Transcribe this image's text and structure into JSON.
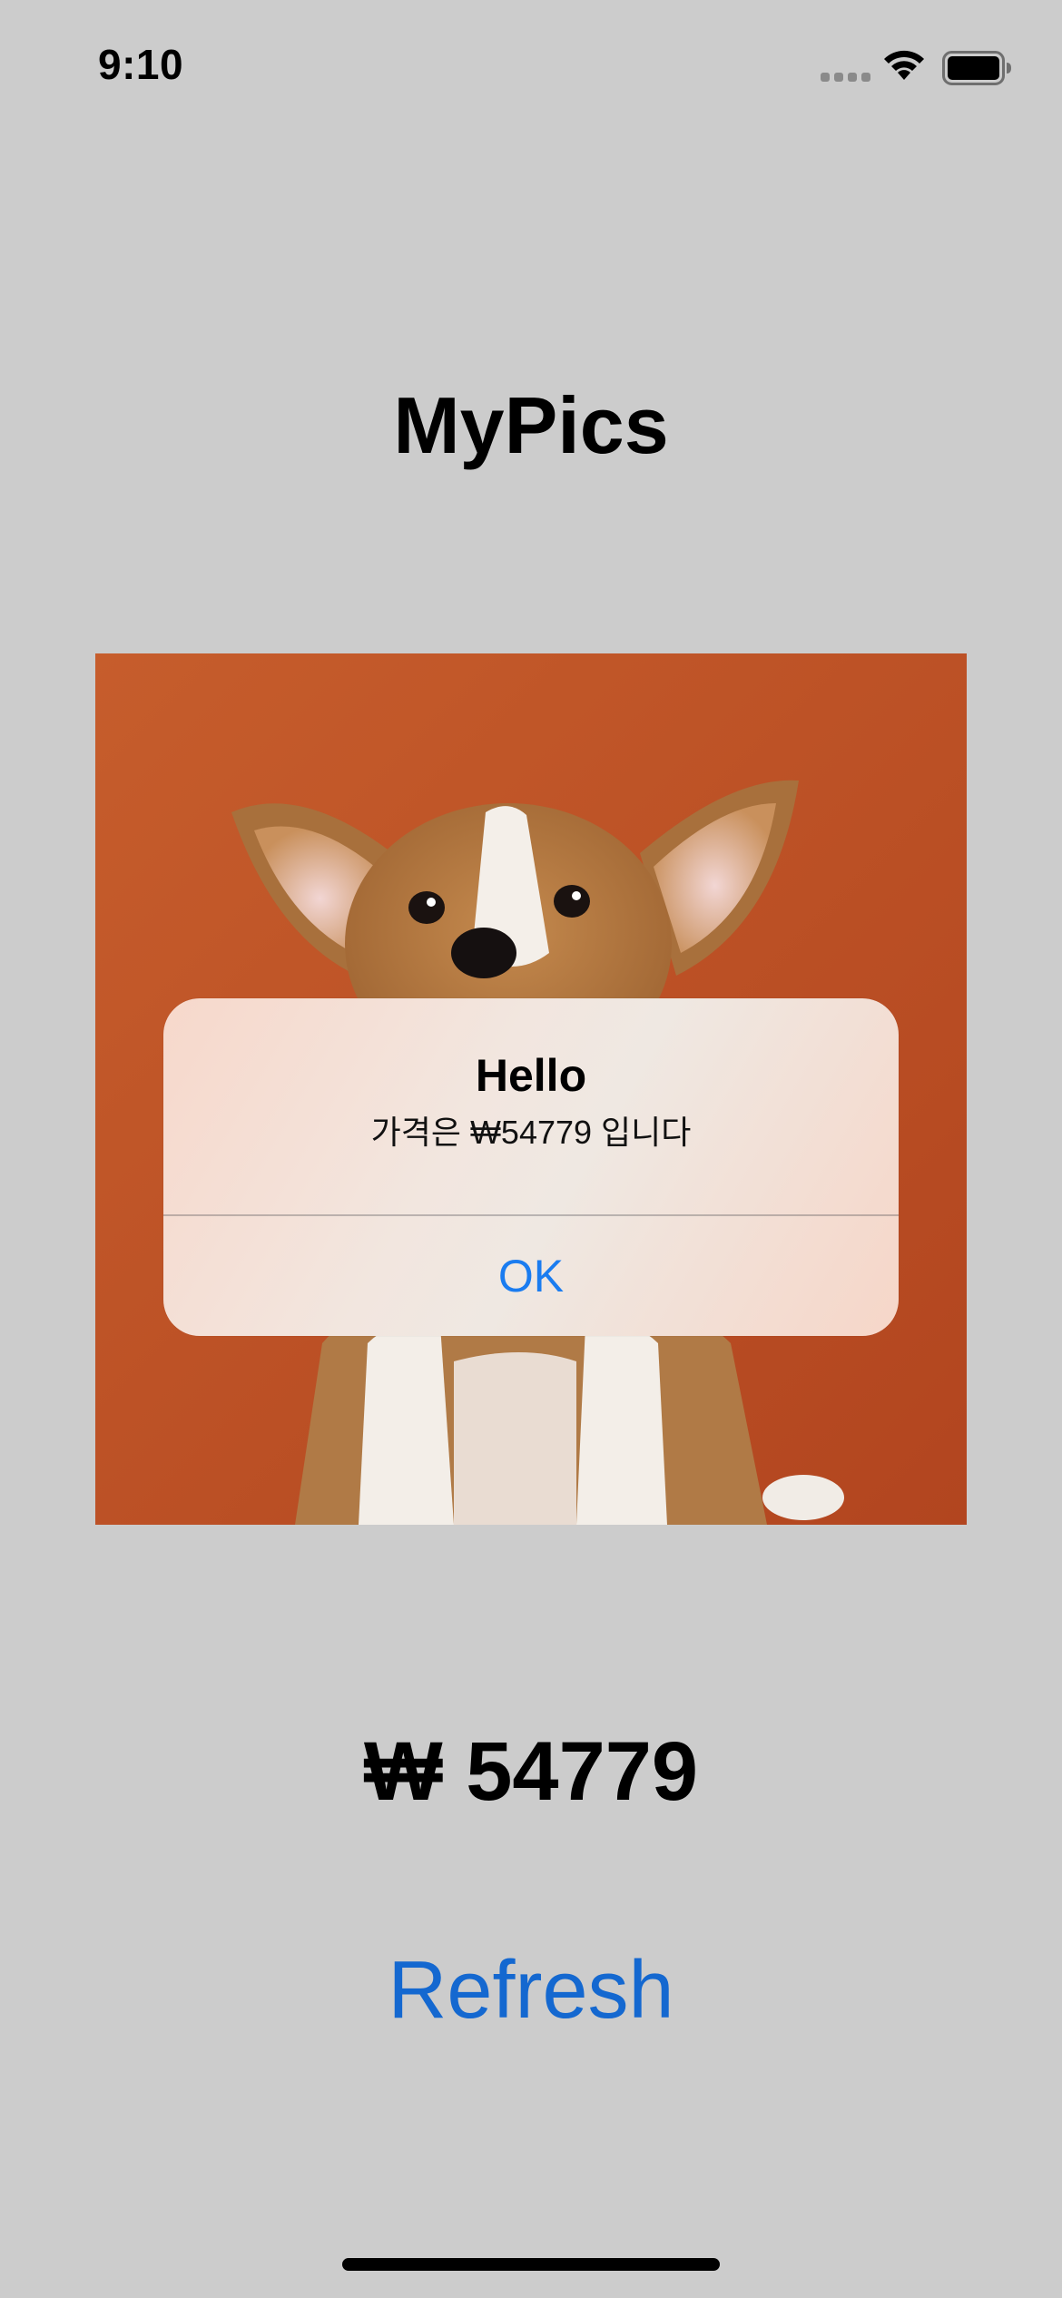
{
  "status_bar": {
    "time": "9:10"
  },
  "app": {
    "title": "MyPics"
  },
  "photo": {
    "subject": "corgi puppy on orange background",
    "background_color": "#c25a2a"
  },
  "alert": {
    "title": "Hello",
    "message": "가격은 ₩54779 입니다",
    "ok_label": "OK"
  },
  "price": {
    "text": "₩ 54779"
  },
  "actions": {
    "refresh_label": "Refresh"
  },
  "colors": {
    "background": "#cccccc",
    "accent": "#1468d0",
    "alert_button": "#1a7cf0"
  },
  "icons": {
    "signal": "cellular-signal-icon",
    "wifi": "wifi-icon",
    "battery": "battery-icon"
  }
}
